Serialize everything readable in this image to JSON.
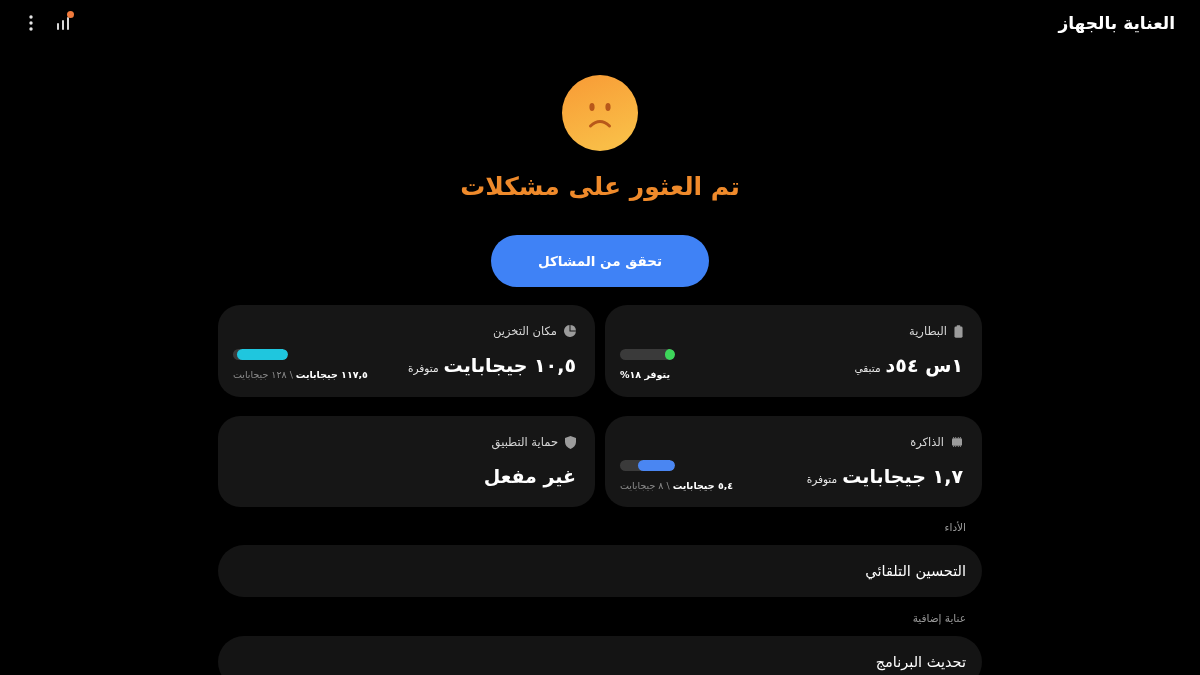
{
  "app_bar": {
    "title": "العناية بالجهاز"
  },
  "status": {
    "title": "تم العثور على مشكلات",
    "button": "تحقق من المشاكل"
  },
  "cards": [
    {
      "kind": "battery",
      "label": "البطارية",
      "value": "١س ٥٤د",
      "unit": "متبقي",
      "level": 0.18,
      "color": "#3dd65a",
      "caption": "يتوفر ١٨%"
    },
    {
      "kind": "storage",
      "label": "مكان التخزين",
      "value": "١٠,٥ جيجابايت",
      "unit": "متوفرة",
      "level": 0.92,
      "color": "#1fc6de",
      "caption": "**١١٧,٥ جيجابايت** \\ ١٢٨ جيجابايت"
    },
    {
      "kind": "memory",
      "label": "الذاكرة",
      "value": "١,٧ جيجابايت",
      "unit": "متوفرة",
      "level": 0.68,
      "color": "#4a86f2",
      "caption": "**٥,٤ جيجابايت** \\ ٨ جيجابايت"
    },
    {
      "kind": "protection",
      "label": "حماية التطبيق",
      "value": "غير مفعل"
    }
  ],
  "sections": [
    {
      "heading": "الأداء",
      "items": [
        {
          "label": "التحسين التلقائي"
        }
      ]
    },
    {
      "heading": "عناية إضافية",
      "items": [
        {
          "label": "تحديث البرنامج"
        }
      ]
    }
  ]
}
